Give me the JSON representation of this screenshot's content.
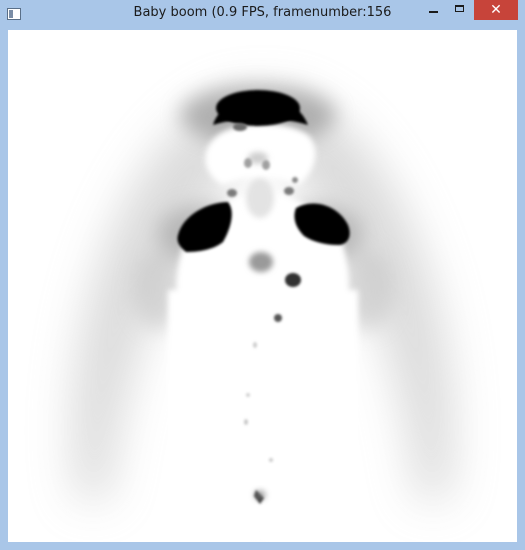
{
  "window": {
    "title": "Baby boom (0.9 FPS, framenumber:156",
    "accent_color": "#a9c6e8",
    "close_color": "#c7443a"
  },
  "controls": {
    "icons": [
      "app-icon",
      "minimize-icon",
      "maximize-icon",
      "close-icon"
    ],
    "close_glyph": "✕"
  }
}
